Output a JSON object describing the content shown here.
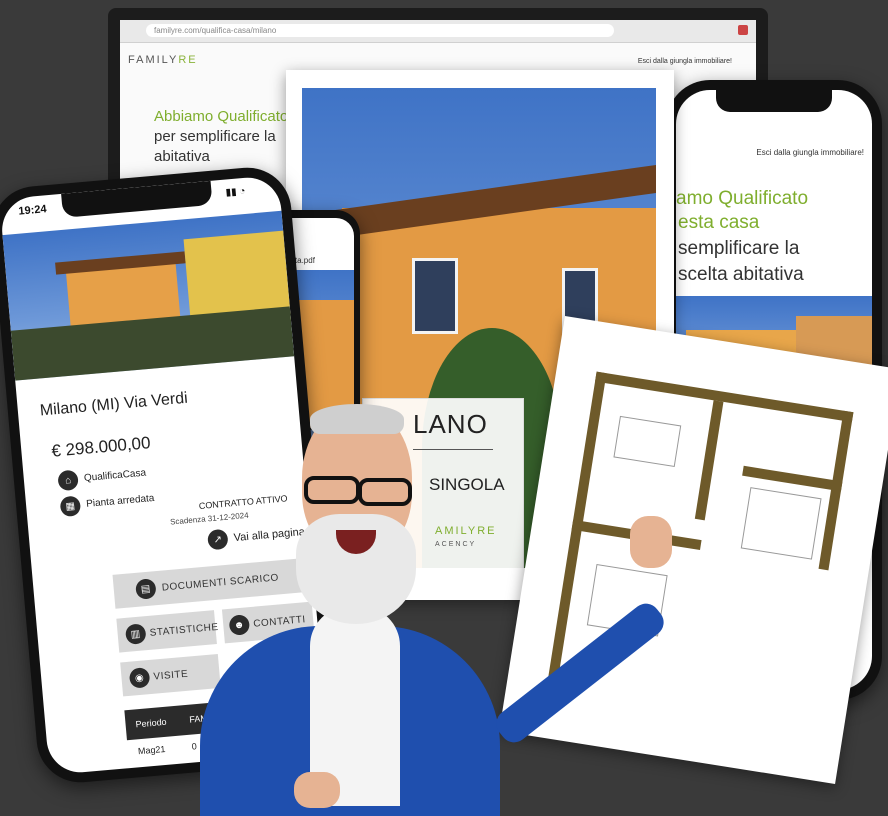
{
  "monitor": {
    "url": "familyre.com/qualifica-casa/milano",
    "brand_main": "FAMILY",
    "brand_accent": "RE",
    "top_link": "Esci dalla giungla immobiliare!",
    "headline_green": "Abbiamo Qualificato",
    "headline_line2": "per semplificare la",
    "headline_line3": "abitativa"
  },
  "right_phone": {
    "top_link": "Esci dalla giungla immobiliare!",
    "line1": "amo Qualificato",
    "line2": "esta casa",
    "line3": "semplificare la",
    "line4": "scelta abitativa"
  },
  "flyer": {
    "city": "LANO",
    "type": "SINGOLA",
    "brand": "AMILYRE",
    "agency": "ACENCY"
  },
  "middle_phone": {
    "filename": "26 ita.pdf"
  },
  "left_phone": {
    "time": "19:24",
    "address": "Milano (MI) Via Verdi",
    "price": "€ 298.000,00",
    "badge1": "QualificaCasa",
    "badge2": "Pianta arredata",
    "contract": "CONTRATTO ATTIVO",
    "contract_expiry": "Scadenza 31-12-2024",
    "link": "Vai alla pagina",
    "btn_docs": "DOCUMENTI SCARICO",
    "btn_stats": "STATISTICHE",
    "btn_contacts": "CONTATTI",
    "btn_visits": "VISITE",
    "table_col1": "Periodo",
    "table_col2": "FAMILYRE",
    "table_row1_col1": "Mag21",
    "table_row1_col2": "0"
  },
  "colors": {
    "accent_green": "#7fae2e",
    "plan_wall": "#6e5a2a",
    "jacket": "#1f4fae"
  }
}
